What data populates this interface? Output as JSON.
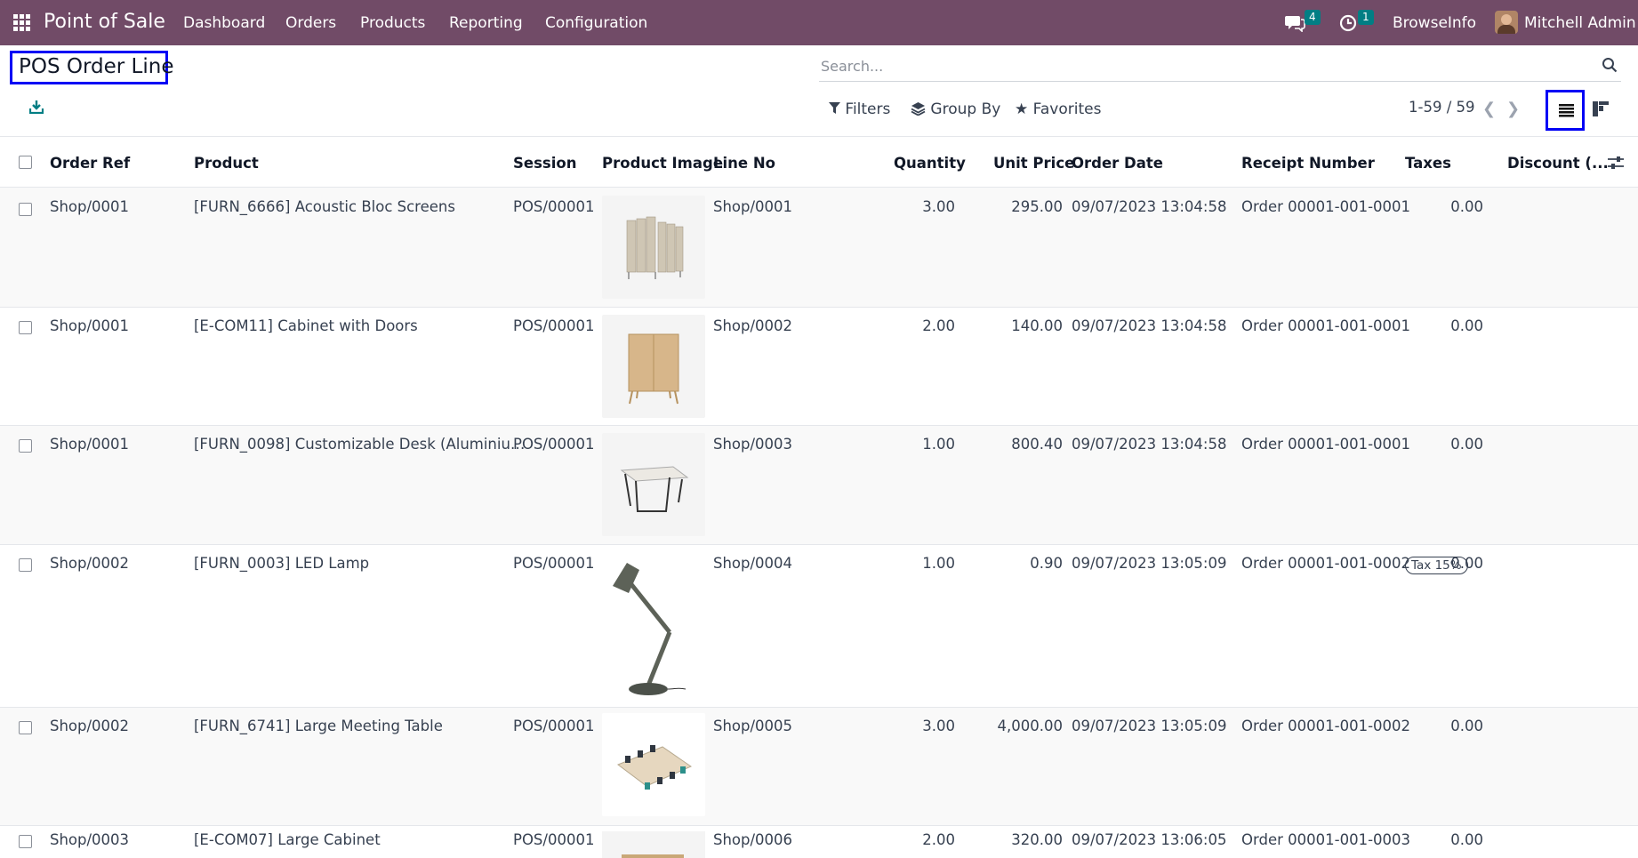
{
  "nav": {
    "app_title": "Point of Sale",
    "menu": [
      "Dashboard",
      "Orders",
      "Products",
      "Reporting",
      "Configuration"
    ],
    "messages_count": "4",
    "activities_count": "1",
    "company": "BrowseInfo",
    "user": "Mitchell Admin"
  },
  "control": {
    "title": "POS Order Line",
    "search_placeholder": "Search...",
    "filters": "Filters",
    "group_by": "Group By",
    "favorites": "Favorites",
    "pager": "1-59 / 59"
  },
  "table": {
    "columns": [
      "Order Ref",
      "Product",
      "Session",
      "Product Image",
      "Line No",
      "Quantity",
      "Unit Price",
      "Order Date",
      "Receipt Number",
      "Taxes",
      "Discount (..."
    ],
    "rows": [
      {
        "order_ref": "Shop/0001",
        "product": "[FURN_6666] Acoustic Bloc Screens",
        "session": "POS/00001",
        "image": "acoustic-screens-image",
        "line_no": "Shop/0001",
        "quantity": "3.00",
        "unit_price": "295.00",
        "order_date": "09/07/2023 13:04:58",
        "receipt": "Order 00001-001-0001",
        "taxes": "",
        "discount": "0.00"
      },
      {
        "order_ref": "Shop/0001",
        "product": "[E-COM11] Cabinet with Doors",
        "session": "POS/00001",
        "image": "cabinet-doors-image",
        "line_no": "Shop/0002",
        "quantity": "2.00",
        "unit_price": "140.00",
        "order_date": "09/07/2023 13:04:58",
        "receipt": "Order 00001-001-0001",
        "taxes": "",
        "discount": "0.00"
      },
      {
        "order_ref": "Shop/0001",
        "product": "[FURN_0098] Customizable Desk (Aluminiu…",
        "session": "POS/00001",
        "image": "desk-image",
        "line_no": "Shop/0003",
        "quantity": "1.00",
        "unit_price": "800.40",
        "order_date": "09/07/2023 13:04:58",
        "receipt": "Order 00001-001-0001",
        "taxes": "",
        "discount": "0.00"
      },
      {
        "order_ref": "Shop/0002",
        "product": "[FURN_0003] LED Lamp",
        "session": "POS/00001",
        "image": "lamp-image",
        "line_no": "Shop/0004",
        "quantity": "1.00",
        "unit_price": "0.90",
        "order_date": "09/07/2023 13:05:09",
        "receipt": "Order 00001-001-0002",
        "taxes": "Tax 15%",
        "discount": "0.00"
      },
      {
        "order_ref": "Shop/0002",
        "product": "[FURN_6741] Large Meeting Table",
        "session": "POS/00001",
        "image": "meeting-table-image",
        "line_no": "Shop/0005",
        "quantity": "3.00",
        "unit_price": "4,000.00",
        "order_date": "09/07/2023 13:05:09",
        "receipt": "Order 00001-001-0002",
        "taxes": "",
        "discount": "0.00"
      },
      {
        "order_ref": "Shop/0003",
        "product": "[E-COM07] Large Cabinet",
        "session": "POS/00001",
        "image": "large-cabinet-image",
        "line_no": "Shop/0006",
        "quantity": "2.00",
        "unit_price": "320.00",
        "order_date": "09/07/2023 13:06:05",
        "receipt": "Order 00001-001-0003",
        "taxes": "",
        "discount": "0.00"
      }
    ]
  },
  "colors": {
    "brand": "#714b67",
    "highlight": "#0000f5",
    "badge": "#017e84"
  }
}
